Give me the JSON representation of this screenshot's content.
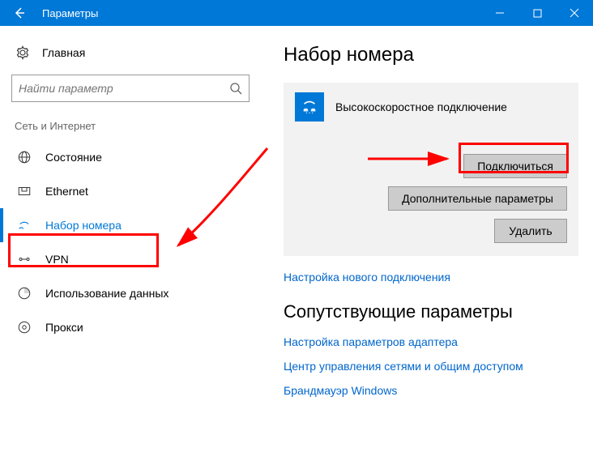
{
  "titlebar": {
    "title": "Параметры"
  },
  "sidebar": {
    "home_label": "Главная",
    "search_placeholder": "Найти параметр",
    "section_label": "Сеть и Интернет",
    "items": [
      {
        "label": "Состояние"
      },
      {
        "label": "Ethernet"
      },
      {
        "label": "Набор номера"
      },
      {
        "label": "VPN"
      },
      {
        "label": "Использование данных"
      },
      {
        "label": "Прокси"
      }
    ]
  },
  "main": {
    "title": "Набор номера",
    "connection": {
      "name": "Высокоскоростное подключение",
      "connect_label": "Подключиться",
      "advanced_label": "Дополнительные параметры",
      "delete_label": "Удалить"
    },
    "new_connection_link": "Настройка нового подключения",
    "related_title": "Сопутствующие параметры",
    "related_links": [
      "Настройка параметров адаптера",
      "Центр управления сетями и общим доступом",
      "Брандмауэр Windows"
    ]
  }
}
